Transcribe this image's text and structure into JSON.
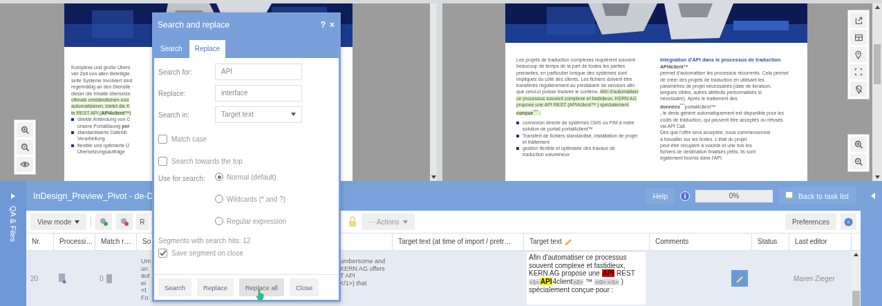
{
  "left_preview": {
    "lines": [
      [
        {
          "text": "Komplexe und große Übers",
          "highlighted": false
        }
      ],
      [
        {
          "text": "viel Zeit von allen Beteiligte",
          "highlighted": false
        }
      ],
      [
        {
          "text": "seite Systeme involviert sind",
          "highlighted": false
        }
      ],
      [
        {
          "text": "regelmäßig an den Dienstle",
          "highlighted": false
        }
      ],
      [
        {
          "text": "dieser die Inhalte übersetze",
          "highlighted": false
        }
      ],
      [
        {
          "text": "oftmals umständlichen und",
          "highlighted": true
        }
      ],
      [
        {
          "text": "automatisieren, bietet die K",
          "highlighted": true
        }
      ],
      [
        {
          "text": "te REST API (**API4client**™)",
          "highlighted": true
        }
      ]
    ],
    "bullets": [
      [
        "direkte Anbindung von C",
        "unsere Portallösung **por**"
      ],
      [
        "standardisierte Dateiüb",
        "Verarbeitung"
      ],
      [
        "flexible und optimierte Ü",
        "Übersetzungsaufträge"
      ]
    ]
  },
  "right_preview": {
    "lines": [
      [
        {
          "text": "Les projets de traduction complexes requièrent souvent",
          "highlighted": false
        }
      ],
      [
        {
          "text": "beaucoup de temps de la part de toutes les parties",
          "highlighted": false
        }
      ],
      [
        {
          "text": "prenantes, en particulier lorsque des systèmes sont",
          "highlighted": false
        }
      ],
      [
        {
          "text": "impliqués du côté des clients. Les fichiers doivent être",
          "highlighted": false
        }
      ],
      [
        {
          "text": "transférés régulièrement au prestataire de services afin",
          "highlighted": false
        }
      ],
      [
        {
          "text": "que celui-ci puisse traduire le contenu. ",
          "highlighted": false
        },
        {
          "text": "Afin d'automatiser",
          "highlighted": true
        }
      ],
      [
        {
          "text": "ce processus souvent complexe et fastidieux, KERN AG",
          "highlighted": true
        }
      ],
      [
        {
          "text": "propose une API REST (API4client™ ) spécialement",
          "highlighted": true
        }
      ],
      [
        {
          "text": "**conçue**$^{***}$ ;",
          "highlighted": true
        }
      ]
    ],
    "bullets": [
      [
        "connexion directe de systèmes CMS ou PIM à notre",
        "solution de portail portal4client™"
      ],
      [
        "Transfert de fichiers standardisé, installation de projet",
        "et traitement"
      ],
      [
        "gestion flexible et optimisée des travaux de",
        "traduction volumineux"
      ]
    ],
    "heading": "Intégration d'API dans le processus de traduction",
    "column_2": [
      "**API4client**™",
      "permet d'automatiser les processus récurrents. Cela permet",
      "de créer des projets de traduction en utilisant les",
      "paramètres de projet nécessaires (date de livraison,",
      "langues cibles, autres attributs personnalisés si",
      "nécessaire). Après le traitement des",
      "**données**$^{***}$portal4client™",
      ", le devis généré automatiquement est disponible pour les",
      "coûts de traduction, qui peuvent être acceptés ou refusés",
      "via API Call.",
      "Dès que l'offre sera acceptée, nous commencerons",
      "à travailler sur les textes. L'état du projet",
      "peut être récupéré à volonté et une fois les",
      "fichiers de destination finalisés prêts, ils sont",
      "également fournis dans l'API."
    ]
  },
  "side_panel": {
    "label": "QA & Files"
  },
  "task": {
    "title": "InDesign_Preview_Pivot - de-D",
    "help": "Help",
    "progress": {
      "level": 0,
      "label": "0%"
    },
    "back": "Back to task list"
  },
  "toolbar": {
    "view_mode": "View mode",
    "cut_button": "R",
    "actions_glyph": "···",
    "actions": "Actions",
    "preferences": "Preferences"
  },
  "columns": [
    "Nr.",
    "Processi…",
    "Match r…",
    "So",
    "Target text (at time of import / pretr…",
    "Target text",
    "Comments",
    "Status",
    "Last editor"
  ],
  "rows": [
    {
      "nr": "20",
      "match": "0",
      "source_left": [
        "Um",
        "un",
        "aut",
        "ei",
        "<t",
        "Fo"
      ],
      "source_right": [
        "umbersome and",
        "KERN AG offers",
        "T API",
        "</1>) that"
      ],
      "target": [
        {
          "kind": "text",
          "text": "Afin d'automatiser ce processus souvent complexe et fastidieux, KERN AG propose une "
        },
        {
          "kind": "hit",
          "text": "API",
          "current": true
        },
        {
          "kind": "text",
          "text": " REST "
        },
        {
          "kind": "tag",
          "text": "<1>"
        },
        {
          "kind": "hit",
          "text": "API",
          "current": false
        },
        {
          "kind": "text",
          "text": "4client"
        },
        {
          "kind": "tag",
          "text": "<2>"
        },
        {
          "kind": "text",
          "text": " ™ "
        },
        {
          "kind": "tag",
          "text": "</2>"
        },
        {
          "kind": "tag",
          "text": "</1>"
        },
        {
          "kind": "text",
          "text": " ) spécialement conçue pour :"
        }
      ],
      "last_editor": "Maren Zieger"
    }
  ],
  "dialog": {
    "title": "Search and replace",
    "help_glyph": "?",
    "close_glyph": "×",
    "tabs": [
      {
        "label": "Search",
        "selected": false
      },
      {
        "label": "Replace",
        "selected": true
      }
    ],
    "fields": [
      {
        "kind": "text",
        "label": "Search for:",
        "value": "API"
      },
      {
        "kind": "text",
        "label": "Replace:",
        "value": "interface"
      },
      {
        "kind": "select",
        "label": "Search in:",
        "value": "Target text"
      }
    ],
    "options": [
      {
        "label": "Match case",
        "checked": false
      },
      {
        "label": "Search towards the top",
        "checked": false
      }
    ],
    "mode_label": "Use for search:",
    "modes": [
      {
        "label": "Normal (default)",
        "selected": true
      },
      {
        "label": "Wildcards (* and ?)",
        "selected": false
      },
      {
        "label": "Regular expression",
        "selected": false
      }
    ],
    "hits": "Segments with search hits: 12",
    "save_option": {
      "label": "Save segment on close",
      "checked": true
    },
    "buttons": [
      {
        "label": "Search",
        "hovered": false
      },
      {
        "label": "Replace",
        "hovered": false
      },
      {
        "label": "Replace all",
        "hovered": true
      },
      {
        "label": "Close",
        "hovered": false
      }
    ]
  }
}
